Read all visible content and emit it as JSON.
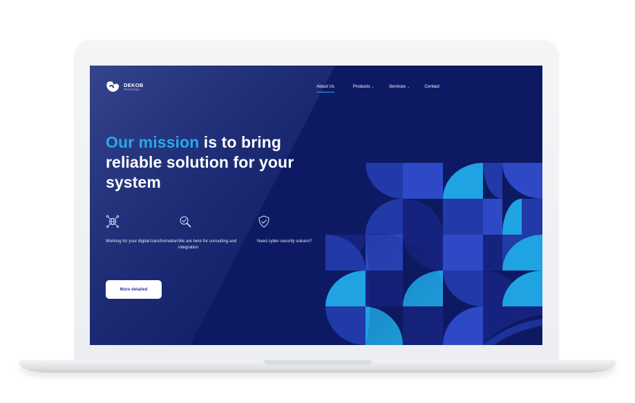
{
  "brand": {
    "name": "DEKOB",
    "tagline": "Technology",
    "logo_icon": "dekob-logo-icon"
  },
  "nav": {
    "items": [
      {
        "label": "About Us",
        "active": true
      },
      {
        "label": "Products",
        "dropdown": true
      },
      {
        "label": "Services",
        "dropdown": true
      },
      {
        "label": "Contact"
      }
    ],
    "caret_glyph": "⌄"
  },
  "hero": {
    "title_accent": "Our mission",
    "title_rest": " is to bring reliable solution for your system"
  },
  "features": [
    {
      "icon": "globe-network-icon",
      "text": "Working for your digital transformation"
    },
    {
      "icon": "search-check-icon",
      "text": "We are here for consulting and integration"
    },
    {
      "icon": "shield-check-icon",
      "text": "Need cyber security soluion?"
    }
  ],
  "cta": {
    "label": "More detailed"
  },
  "colors": {
    "background": "#0d1a63",
    "accent": "#29a8e9",
    "pattern_dark": "#16237e",
    "pattern_mid": "#2239a8",
    "pattern_blue": "#2e49c6",
    "pattern_light": "#1fa3e2",
    "button_text": "#243a9c"
  }
}
